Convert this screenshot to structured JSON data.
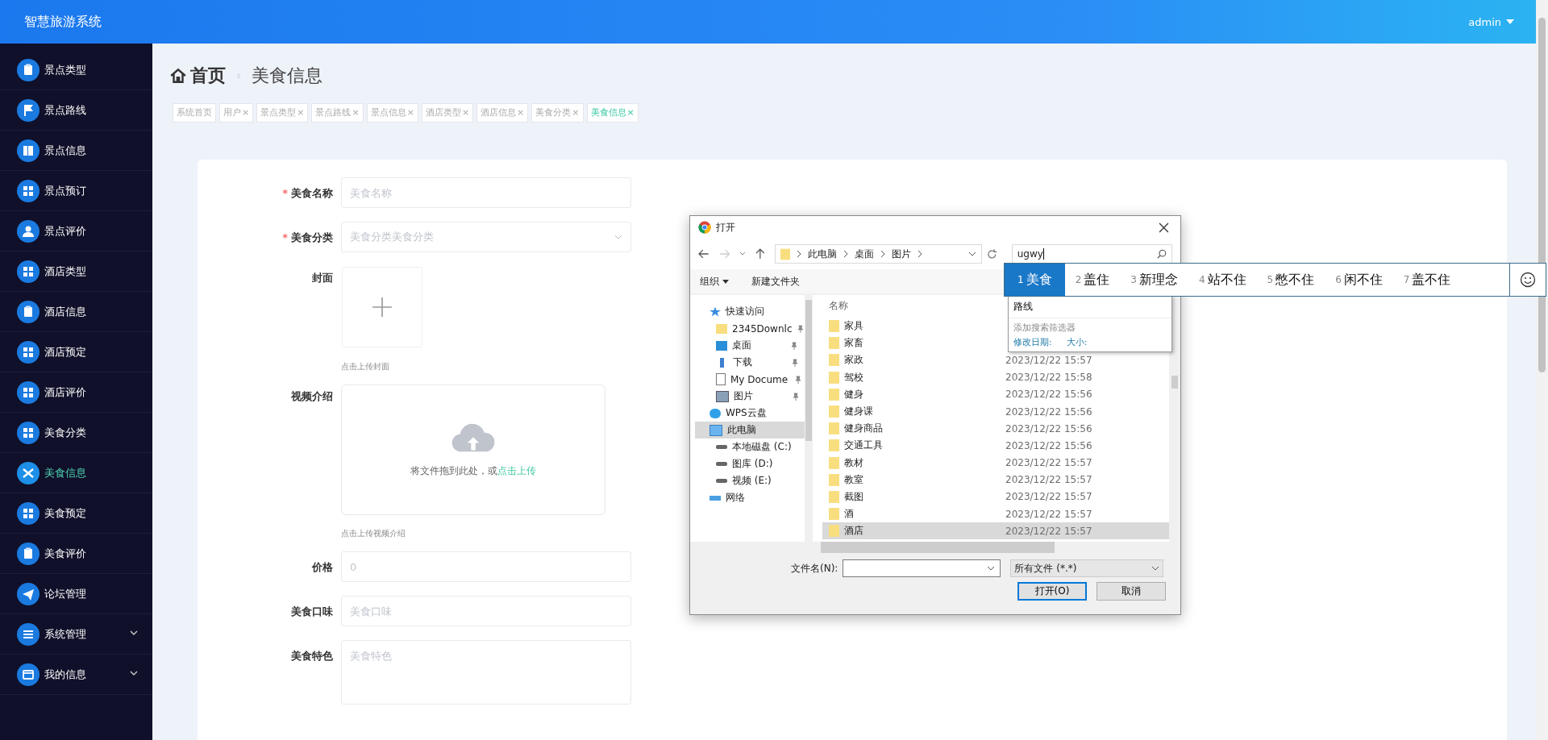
{
  "header": {
    "title": "智慧旅游系统",
    "user": "admin"
  },
  "sidebar": {
    "items": [
      {
        "label": "景点类型",
        "selected": false
      },
      {
        "label": "景点路线",
        "selected": false
      },
      {
        "label": "景点信息",
        "selected": false
      },
      {
        "label": "景点预订",
        "selected": false
      },
      {
        "label": "景点评价",
        "selected": false
      },
      {
        "label": "酒店类型",
        "selected": false
      },
      {
        "label": "酒店信息",
        "selected": false
      },
      {
        "label": "酒店预定",
        "selected": false
      },
      {
        "label": "酒店评价",
        "selected": false
      },
      {
        "label": "美食分类",
        "selected": false
      },
      {
        "label": "美食信息",
        "selected": true
      },
      {
        "label": "美食预定",
        "selected": false
      },
      {
        "label": "美食评价",
        "selected": false
      },
      {
        "label": "论坛管理",
        "selected": false
      },
      {
        "label": "系统管理",
        "selected": false,
        "expandable": true
      },
      {
        "label": "我的信息",
        "selected": false,
        "expandable": true
      }
    ]
  },
  "breadcrumb": {
    "home": "首页",
    "current": "美食信息"
  },
  "tabs": [
    {
      "label": "系统首页",
      "selected": false
    },
    {
      "label": "用户",
      "close": "×",
      "selected": false
    },
    {
      "label": "景点类型",
      "close": "×",
      "selected": false
    },
    {
      "label": "景点路线",
      "close": "×",
      "selected": false
    },
    {
      "label": "景点信息",
      "close": "×",
      "selected": false
    },
    {
      "label": "酒店类型",
      "close": "×",
      "selected": false
    },
    {
      "label": "酒店信息",
      "close": "×",
      "selected": false
    },
    {
      "label": "美食分类",
      "close": "×",
      "selected": false
    },
    {
      "label": "美食信息",
      "close": "×",
      "selected": true
    }
  ],
  "form": {
    "fields": [
      {
        "kind": "input",
        "label": "美食名称",
        "required_mark": "*",
        "placeholder": "美食名称"
      },
      {
        "kind": "select",
        "label": "美食分类",
        "required_mark": "*",
        "placeholder": "美食分类美食分类"
      },
      {
        "kind": "image",
        "label": "封面",
        "hint": "点击上传封面"
      },
      {
        "kind": "video",
        "label": "视频介绍",
        "drop_text": "将文件拖到此处，或",
        "link": "点击上传",
        "hint": "点击上传视频介绍"
      },
      {
        "kind": "input",
        "label": "价格",
        "placeholder": "0"
      },
      {
        "kind": "input",
        "label": "美食口味",
        "placeholder": "美食口味"
      },
      {
        "kind": "textarea",
        "label": "美食特色",
        "placeholder": "美食特色"
      }
    ]
  },
  "dialog": {
    "title": "打开",
    "path": [
      "此电脑",
      "桌面",
      "图片"
    ],
    "search_value": "ugwy",
    "toolbar": {
      "organize": "组织",
      "new_folder": "新建文件夹"
    },
    "nav": [
      {
        "label": "快速访问",
        "selected": false,
        "children": [
          {
            "label": "2345Downlc",
            "pinned": true
          },
          {
            "label": "桌面",
            "pinned": true
          },
          {
            "label": "下载",
            "pinned": true
          },
          {
            "label": "My Docume",
            "pinned": true
          },
          {
            "label": "图片",
            "pinned": true
          }
        ]
      },
      {
        "label": "WPS云盘",
        "selected": false
      },
      {
        "label": "此电脑",
        "selected": true,
        "children": [
          {
            "label": "本地磁盘 (C:)"
          },
          {
            "label": "图库 (D:)"
          },
          {
            "label": "视频 (E:)"
          }
        ]
      },
      {
        "label": "网络",
        "selected": false
      }
    ],
    "column": "名称",
    "files": [
      {
        "name": "家具",
        "selected": false
      },
      {
        "name": "家畜",
        "selected": false
      },
      {
        "name": "家政",
        "date": "2023/12/22 15:57",
        "selected": false
      },
      {
        "name": "驾校",
        "date": "2023/12/22 15:58",
        "selected": false
      },
      {
        "name": "健身",
        "date": "2023/12/22 15:56",
        "selected": false
      },
      {
        "name": "健身课",
        "date": "2023/12/22 15:56",
        "selected": false
      },
      {
        "name": "健身商品",
        "date": "2023/12/22 15:56",
        "selected": false
      },
      {
        "name": "交通工具",
        "date": "2023/12/22 15:56",
        "selected": false
      },
      {
        "name": "教材",
        "date": "2023/12/22 15:57",
        "selected": false
      },
      {
        "name": "教室",
        "date": "2023/12/22 15:57",
        "selected": false
      },
      {
        "name": "截图",
        "date": "2023/12/22 15:57",
        "selected": false
      },
      {
        "name": "酒",
        "date": "2023/12/22 15:57",
        "selected": false
      },
      {
        "name": "酒店",
        "date": "2023/12/22 15:57",
        "selected": true
      }
    ],
    "filename_label": "文件名(N):",
    "filetype": "所有文件 (*.*)",
    "open_button": "打开(O)",
    "cancel_button": "取消",
    "search_dropdown": {
      "history": [
        "路线"
      ],
      "add_filter": "添加搜索筛选器",
      "filters": [
        "修改日期:",
        "大小:"
      ]
    }
  },
  "ime": {
    "candidates": [
      {
        "num": "1",
        "text": "美食",
        "selected": true
      },
      {
        "num": "2",
        "text": "盖住",
        "selected": false
      },
      {
        "num": "3",
        "text": "新理念",
        "selected": false
      },
      {
        "num": "4",
        "text": "站不住",
        "selected": false
      },
      {
        "num": "5",
        "text": "憋不住",
        "selected": false
      },
      {
        "num": "6",
        "text": "闲不住",
        "selected": false
      },
      {
        "num": "7",
        "text": "盖不住",
        "selected": false
      }
    ]
  }
}
